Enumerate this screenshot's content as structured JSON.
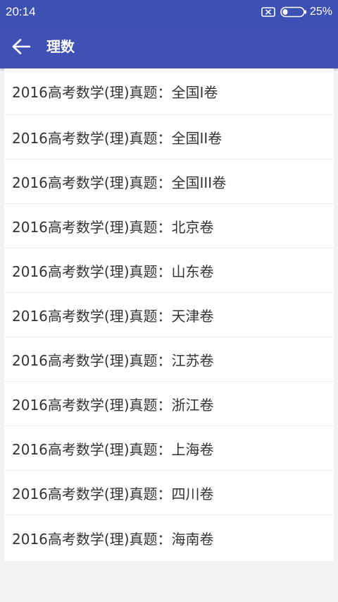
{
  "status_bar": {
    "time": "20:14",
    "battery_percent": "25%",
    "battery_level": 0.25,
    "icons": [
      "no-sim-icon",
      "battery-icon"
    ]
  },
  "app_bar": {
    "back_icon": "arrow-left-icon",
    "title": "理数"
  },
  "list": {
    "items": [
      {
        "label": "2016高考数学(理)真题：全国I卷"
      },
      {
        "label": "2016高考数学(理)真题：全国II卷"
      },
      {
        "label": "2016高考数学(理)真题：全国III卷"
      },
      {
        "label": "2016高考数学(理)真题：北京卷"
      },
      {
        "label": "2016高考数学(理)真题：山东卷"
      },
      {
        "label": "2016高考数学(理)真题：天津卷"
      },
      {
        "label": "2016高考数学(理)真题：江苏卷"
      },
      {
        "label": "2016高考数学(理)真题：浙江卷"
      },
      {
        "label": "2016高考数学(理)真题：上海卷"
      },
      {
        "label": "2016高考数学(理)真题：四川卷"
      },
      {
        "label": "2016高考数学(理)真题：海南卷"
      }
    ]
  },
  "colors": {
    "primary": "#3f51b5",
    "status_bar": "#3d50b3",
    "background": "#f2f2f2",
    "text": "#333333"
  }
}
